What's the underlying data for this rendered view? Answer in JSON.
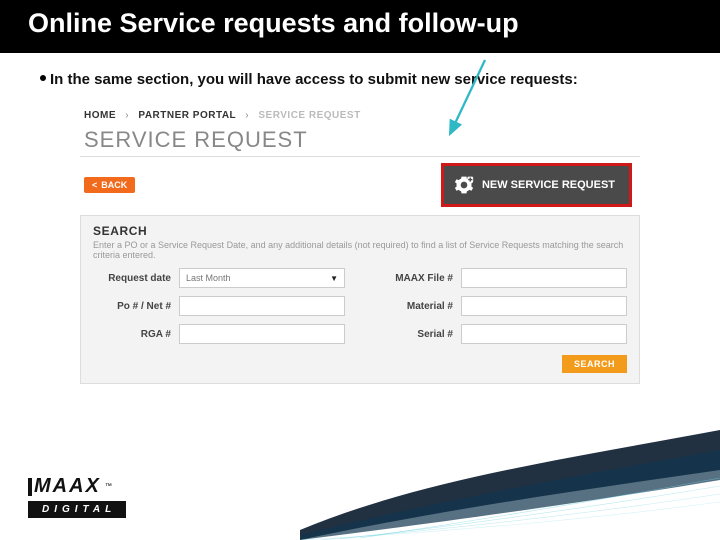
{
  "header": {
    "title": "Online Service requests and follow-up"
  },
  "bullet": "In the same section, you will have access to submit new service requests:",
  "breadcrumb": {
    "item1": "HOME",
    "item2": "PARTNER PORTAL",
    "item3": "SERVICE REQUEST",
    "sep": "›"
  },
  "page_title": "SERVICE REQUEST",
  "back_btn": {
    "chev": "<",
    "label": "BACK"
  },
  "new_request_btn": {
    "label": "NEW SERVICE REQUEST"
  },
  "search_panel": {
    "title": "SEARCH",
    "desc": "Enter a PO or a Service Request Date, and any additional details (not required) to find a list of Service Requests matching the search criteria entered.",
    "fields": {
      "request_date": {
        "label": "Request date",
        "value": "Last Month",
        "caret": "▼"
      },
      "maax_file": {
        "label": "MAAX File #",
        "value": ""
      },
      "po_net": {
        "label": "Po # / Net #",
        "value": ""
      },
      "material": {
        "label": "Material #",
        "value": ""
      },
      "rga": {
        "label": "RGA #",
        "value": ""
      },
      "serial": {
        "label": "Serial #",
        "value": ""
      }
    },
    "search_btn": "SEARCH"
  },
  "logo": {
    "brand": "MAAX",
    "sub": "DIGITAL",
    "tm": "™"
  },
  "colors": {
    "accent_orange": "#f26a1b",
    "accent_yellow": "#f39c1b",
    "highlight_red": "#d01818",
    "arrow": "#2fb8c5"
  }
}
